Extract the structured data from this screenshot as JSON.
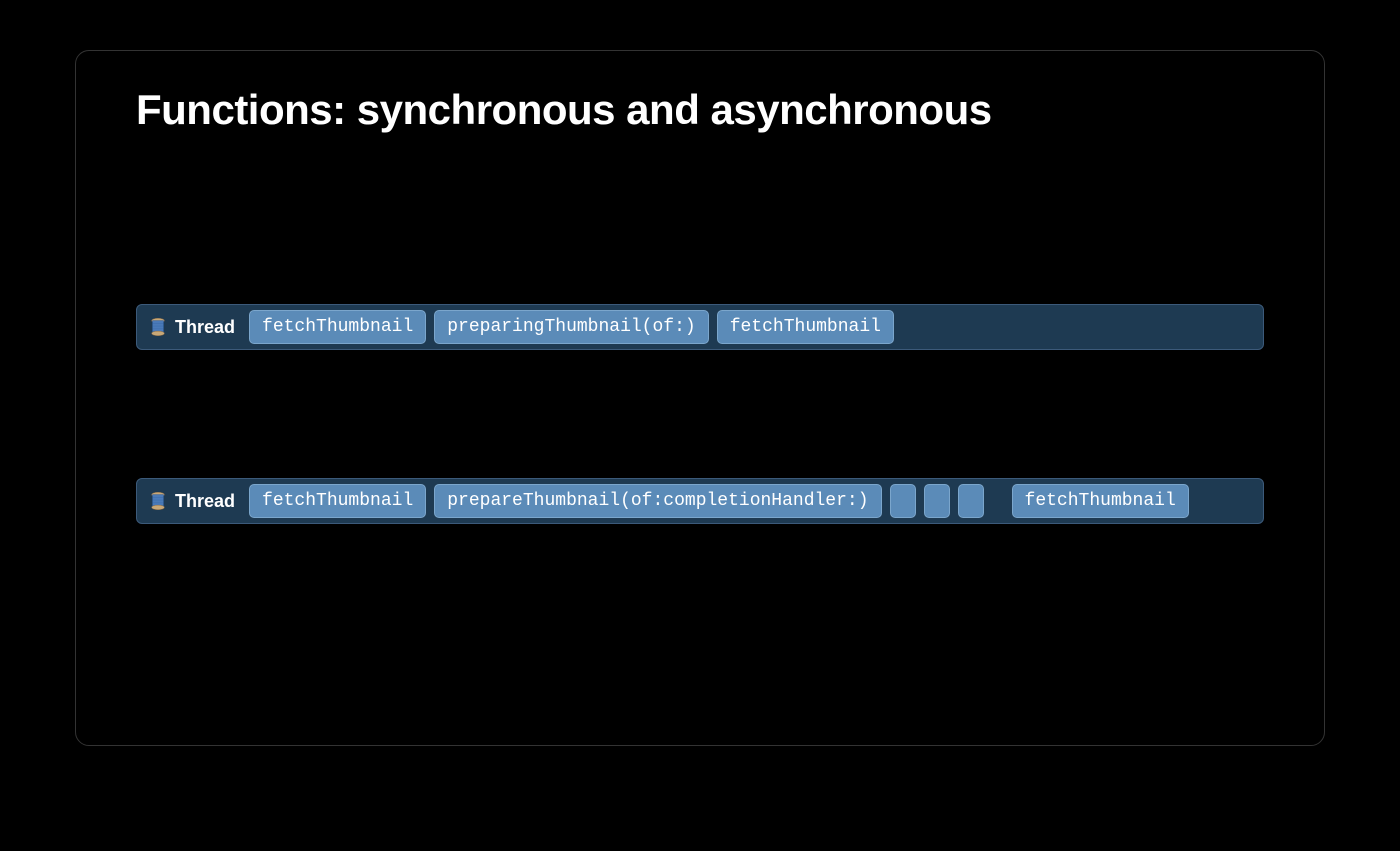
{
  "title": "Functions: synchronous and asynchronous",
  "threads": {
    "row1": {
      "label": "Thread",
      "blocks": [
        {
          "text": "fetchThumbnail",
          "type": "code"
        },
        {
          "text": "preparingThumbnail(of:)",
          "type": "code"
        },
        {
          "text": "fetchThumbnail",
          "type": "code"
        }
      ]
    },
    "row2": {
      "label": "Thread",
      "blocks": [
        {
          "text": "fetchThumbnail",
          "type": "code"
        },
        {
          "text": "prepareThumbnail(of:completionHandler:)",
          "type": "code"
        },
        {
          "text": "",
          "type": "small"
        },
        {
          "text": "",
          "type": "small"
        },
        {
          "text": "",
          "type": "small"
        },
        {
          "text": "fetchThumbnail",
          "type": "code"
        }
      ]
    }
  }
}
